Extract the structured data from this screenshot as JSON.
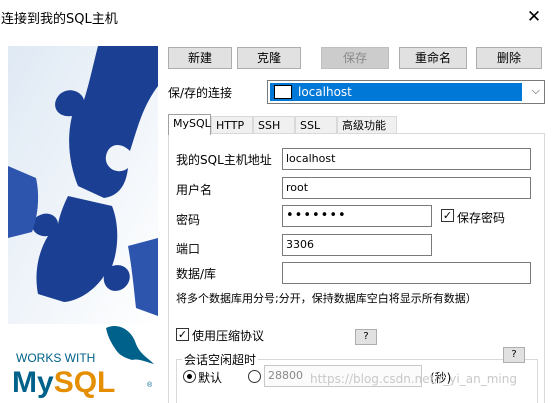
{
  "window": {
    "title": "连接到我的SQL主机",
    "close_glyph": "✕"
  },
  "logo": {
    "line1": "WORKS WITH",
    "line2": "MySQL",
    "registered": "®"
  },
  "toolbar": {
    "new": "新建",
    "clone": "克隆",
    "save": "保存",
    "rename": "重命名",
    "delete": "删除"
  },
  "connection": {
    "label": "保/存的连接",
    "selected": "localhost"
  },
  "tabs": [
    "MySQL",
    "HTTP",
    "SSH",
    "SSL",
    "高级功能"
  ],
  "form": {
    "host_label": "我的SQL主机地址",
    "host_value": "localhost",
    "user_label": "用户名",
    "user_value": "root",
    "password_label": "密码",
    "password_value": "•••••••",
    "save_password_label": "保存密码",
    "port_label": "端口",
    "port_value": "3306",
    "database_label": "数据/库",
    "database_value": "",
    "database_hint": "将多个数据库用分号;分开，保持数据库空白将显示所有数据）",
    "compress_label": "使用压缩协议",
    "help": "?"
  },
  "session": {
    "title": "会话空闲超时",
    "default_label": "默认",
    "custom_value": "28800",
    "unit": "(秒)"
  },
  "watermark": "https://blog.csdn.net/r_yi_an_ming",
  "colors": {
    "selection": "#0078d7",
    "puzzle_blue": "#1a3f93",
    "mysql_blue": "#00618a",
    "mysql_orange": "#e48e00"
  }
}
